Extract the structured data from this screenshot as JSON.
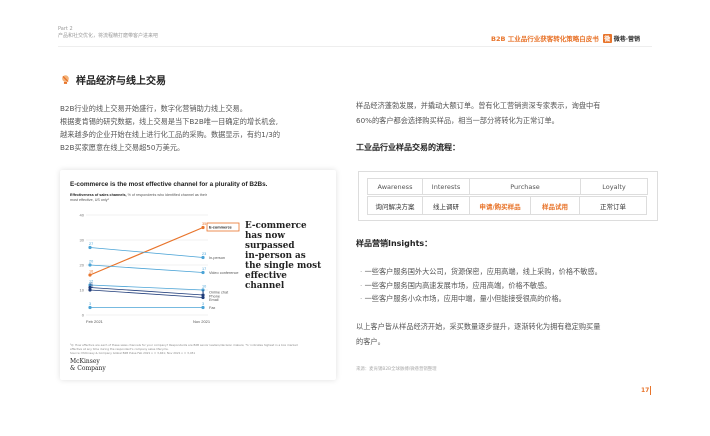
{
  "header": {
    "part": "Part 2",
    "part_subtitle": "产品和社交优化，将流程精打磨带客户进来吧",
    "report_title": "B2B 工业品行业获客转化策略白皮书",
    "logo_text": "微巷·营销"
  },
  "section": {
    "title": "样品经济与线上交易",
    "icon": "bulb-icon"
  },
  "left": {
    "paragraphs": [
      "B2B行业的线上交易开始盛行，数字化营销助力线上交易。",
      "根据麦肯锡的研究数据，线上交易是当下B2B唯一目确定的增长机会,",
      "越来越多的企业开始在线上进行化工品的采购。数据显示，有约1/3的",
      "B2B买家愿意在线上交易超50万美元。"
    ]
  },
  "figure": {
    "title": "E-commerce is the most effective channel for a plurality of B2Bs.",
    "subtitle_bold": "Effectiveness of sales channels,",
    "subtitle_rest": " % of respondents who identified channel as their",
    "subtitle_line2": "most effective, US only¹",
    "headline_lines": [
      "E-commerce",
      "has now",
      "surpassed",
      "in-person as",
      "the single most",
      "effective",
      "channel"
    ],
    "footnote_lines": [
      "¹Q: How effective are each of these sales channels for your company? Respondents are B2B senior leaders/decision makers; '%' indicates highest in a box marked effective at any time during the respondent's company sales lifecycle.",
      "Source: McKinsey & Company Global B2B Pulse Feb 2021 n = 3,461; Nov 2021 n = 3,451"
    ],
    "brand_lines": [
      "McKinsey",
      "& Company"
    ]
  },
  "chart_data": {
    "type": "line",
    "x": [
      "Feb 2021",
      "Nov 2021"
    ],
    "ylim": [
      0,
      40
    ],
    "yticks": [
      0,
      10,
      20,
      30,
      40
    ],
    "series": [
      {
        "name": "E-commerce",
        "values": [
          16,
          35
        ],
        "color": "#e8742b"
      },
      {
        "name": "In-person",
        "values": [
          27,
          23
        ],
        "color": "#4aa3d6"
      },
      {
        "name": "Video conference",
        "values": [
          20,
          17
        ],
        "color": "#4aa3d6"
      },
      {
        "name": "Online chat",
        "values": [
          12,
          10
        ],
        "color": "#4aa3d6"
      },
      {
        "name": "Phone",
        "values": [
          10,
          7
        ],
        "color": "#1f3c7a"
      },
      {
        "name": "Email",
        "values": [
          11,
          8
        ],
        "color": "#1f3c7a"
      },
      {
        "name": "Fax",
        "values": [
          3,
          3
        ],
        "color": "#4aa3d6"
      }
    ]
  },
  "right": {
    "intro_lines": [
      "样品经济蓬勃发展，并撬动大额订单。曾有化工营销资深专家表示，询盘中有",
      "60%的客户都会选择购买样品，相当一部分将转化为正常订单。"
    ],
    "flow_title": "工业品行业样品交易的流程：",
    "flow_headers": [
      "Awareness",
      "Interests",
      "Purchase",
      "Loyalty"
    ],
    "flow_steps": [
      "询问解决方案",
      "线上调研",
      "申请/购买样品",
      "样品试用",
      "正常订单"
    ],
    "insights_title": "样品营销Insights：",
    "insights": [
      "一些客户服务国外大公司，货源保密，应用高端，线上采购，价格不敏感。",
      "一些客户服务国内高速发展市场，应用高端，价格不敏感。",
      "一些客户服务小众市场，应用中端，量小但能接受很高的价格。"
    ],
    "conclusion_lines": [
      "以上客户皆从样品经济开始，采买数量逐步提升，逐渐转化为拥有稳定购买量",
      "的客户。"
    ],
    "source": "来源：麦肯锡B2B全球脉搏/微巷营销整理"
  },
  "page_number": "17"
}
